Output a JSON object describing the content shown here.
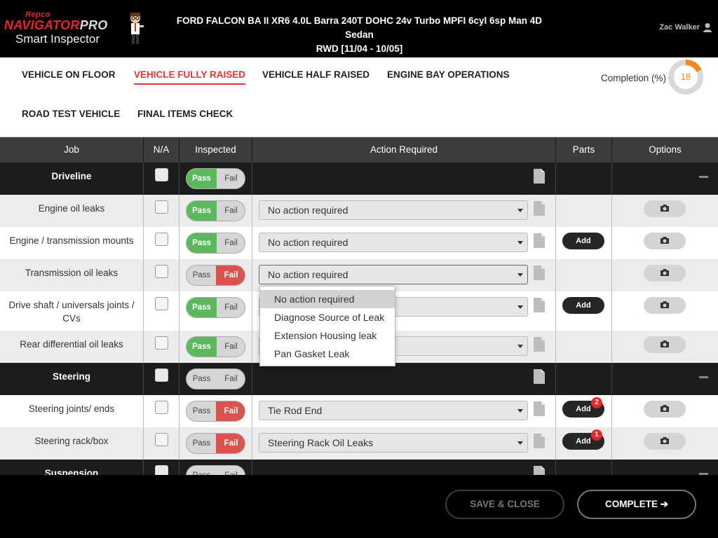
{
  "header": {
    "brand_top": "Repco",
    "brand_main": "NAVIGATOR",
    "brand_pro": "PRO",
    "brand_sub": "Smart Inspector",
    "vehicle_line1": "FORD FALCON BA II XR6 4.0L Barra 240T DOHC 24v Turbo MPFI 6cyl 6sp Man 4D Sedan",
    "vehicle_line2": "RWD [11/04 - 10/05]",
    "user_name": "Zac Walker",
    "user_icon": "user-icon"
  },
  "tabs": [
    {
      "label": "VEHICLE ON FLOOR",
      "active": false
    },
    {
      "label": "VEHICLE FULLY RAISED",
      "active": true
    },
    {
      "label": "VEHICLE HALF RAISED",
      "active": false
    },
    {
      "label": "ENGINE BAY OPERATIONS",
      "active": false
    },
    {
      "label": "ROAD TEST VEHICLE",
      "active": false
    },
    {
      "label": "FINAL ITEMS CHECK",
      "active": false
    }
  ],
  "completion": {
    "label": "Completion (%)",
    "value": "18",
    "percent": 18,
    "color": "#f28a1b"
  },
  "table": {
    "headers": {
      "job": "Job",
      "na": "N/A",
      "inspected": "Inspected",
      "action": "Action Required",
      "parts": "Parts",
      "options": "Options"
    },
    "pass_label": "Pass",
    "fail_label": "Fail",
    "add_label": "Add",
    "rows": [
      {
        "type": "section",
        "job": "Driveline",
        "state": "pass"
      },
      {
        "type": "item",
        "job": "Engine oil leaks",
        "state": "pass",
        "action": "No action required",
        "parts": false
      },
      {
        "type": "item",
        "job": "Engine / transmission mounts",
        "state": "pass",
        "action": "No action required",
        "parts": true
      },
      {
        "type": "item",
        "job": "Transmission oil leaks",
        "state": "fail",
        "action": "No action required",
        "parts": false
      },
      {
        "type": "item",
        "job": "Drive shaft / universals joints / CVs",
        "state": "pass",
        "action": "",
        "parts": true
      },
      {
        "type": "item",
        "job": "Rear differential oil leaks",
        "state": "pass",
        "action": "",
        "parts": false
      },
      {
        "type": "section",
        "job": "Steering",
        "state": "none"
      },
      {
        "type": "item",
        "job": "Steering joints/ ends",
        "state": "fail",
        "action": "Tie Rod End",
        "parts": true,
        "badge": "2"
      },
      {
        "type": "item",
        "job": "Steering rack/box",
        "state": "fail",
        "action": "Steering Rack Oil Leaks",
        "parts": true,
        "badge": "1"
      },
      {
        "type": "section",
        "job": "Suspension",
        "state": "none"
      }
    ]
  },
  "dropdown": {
    "options": [
      "No action required",
      "Diagnose Source of Leak",
      "Extension Housing leak",
      "Pan Gasket Leak"
    ],
    "selected": "No action required"
  },
  "footer": {
    "save_close": "SAVE & CLOSE",
    "complete": "COMPLETE ➔"
  },
  "colors": {
    "pass": "#5cb85c",
    "fail": "#d9534f",
    "accent": "#e23535",
    "brand_red": "#e8262a"
  }
}
